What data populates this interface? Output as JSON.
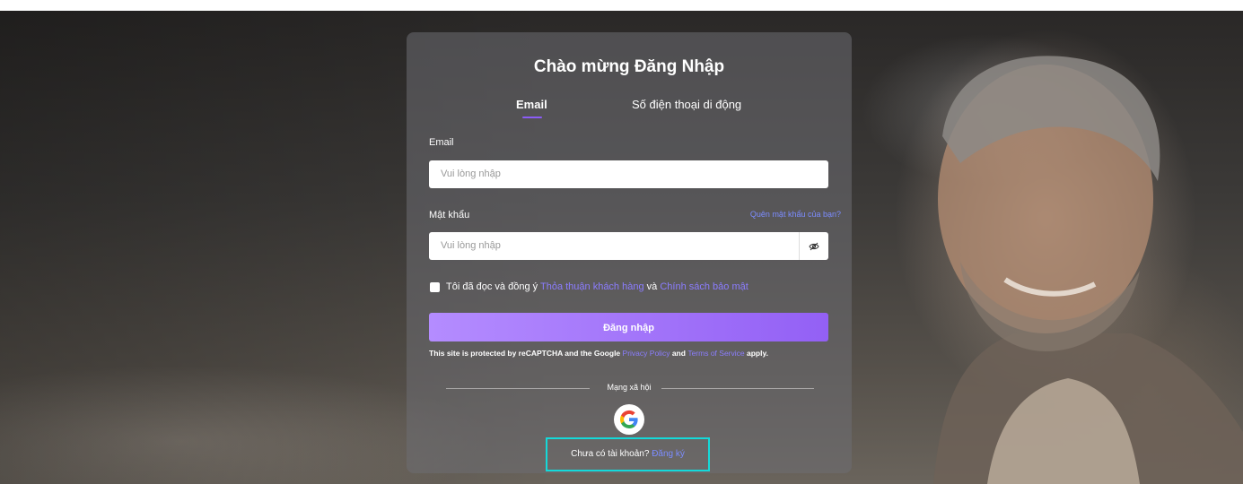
{
  "page": {
    "title": "Chào mừng Đăng Nhập",
    "tabs": [
      {
        "label": "Email",
        "active": true
      },
      {
        "label": "Số điện thoại di động",
        "active": false
      }
    ]
  },
  "form": {
    "email_label": "Email",
    "email_placeholder": "Vui lòng nhập",
    "password_label": "Mật khẩu",
    "password_placeholder": "Vui lòng nhập",
    "forgot_link": "Quên mật khẩu của bạn?",
    "agree_text_prefix": "Tôi đã đọc và đồng ý",
    "agree_link_1": "Thỏa thuận khách hàng",
    "agree_and": "và",
    "agree_link_2": "Chính sách bảo mật",
    "login_button": "Đăng nhập",
    "recaptcha_prefix": "This site is protected by reCAPTCHA and the Google",
    "recaptcha_privacy": "Privacy Policy",
    "recaptcha_and": "and",
    "recaptcha_terms": "Terms of Service",
    "recaptcha_suffix": "apply."
  },
  "social": {
    "label": "Mạng xã hội",
    "icons": [
      "google-icon"
    ]
  },
  "signup": {
    "prompt": "Chưa có tài khoản?",
    "link": "Đăng ký"
  },
  "colors": {
    "accent": "#8b5cf6",
    "link": "#7c8cff",
    "highlight_border": "#14d9d9"
  }
}
